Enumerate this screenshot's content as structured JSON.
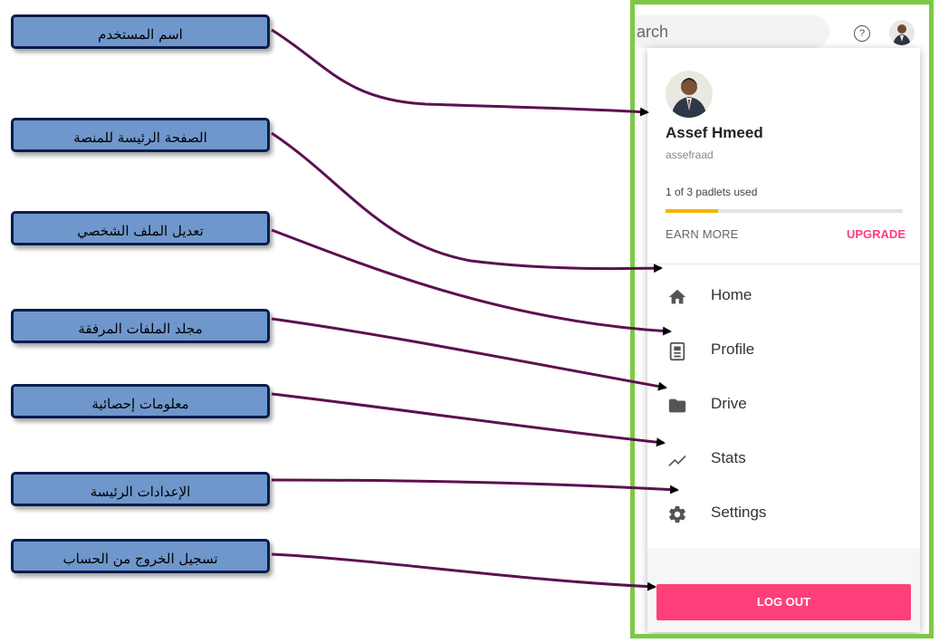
{
  "callouts": [
    "اسم المستخدم",
    "الصفحة الرئيسة للمنصة",
    "تعديل الملف الشخصي",
    "مجلد الملفات المرفقة",
    "معلومات إحصائية",
    "الإعدادات الرئيسة",
    "تسجيل الخروج من الحساب"
  ],
  "topbar": {
    "search_text": "arch",
    "help_icon": "help-circle-icon",
    "avatar_icon": "user-avatar"
  },
  "profile": {
    "name": "Assef Hmeed",
    "handle": "assefraad",
    "usage_text": "1 of 3 padlets used",
    "usage_fraction": 0.22,
    "earn_more": "EARN MORE",
    "upgrade": "UPGRADE"
  },
  "menu": [
    {
      "label": "Home",
      "icon": "home-icon"
    },
    {
      "label": "Profile",
      "icon": "profile-icon"
    },
    {
      "label": "Drive",
      "icon": "folder-icon"
    },
    {
      "label": "Stats",
      "icon": "stats-icon"
    },
    {
      "label": "Settings",
      "icon": "gear-icon"
    }
  ],
  "logout_label": "LOG OUT",
  "colors": {
    "frame_border": "#7dc944",
    "callout_fill": "#6f97cc",
    "callout_border": "#0b1d4d",
    "arrow": "#5c1150",
    "accent_pink": "#ff3f7a",
    "usage_fill": "#f5b400"
  }
}
